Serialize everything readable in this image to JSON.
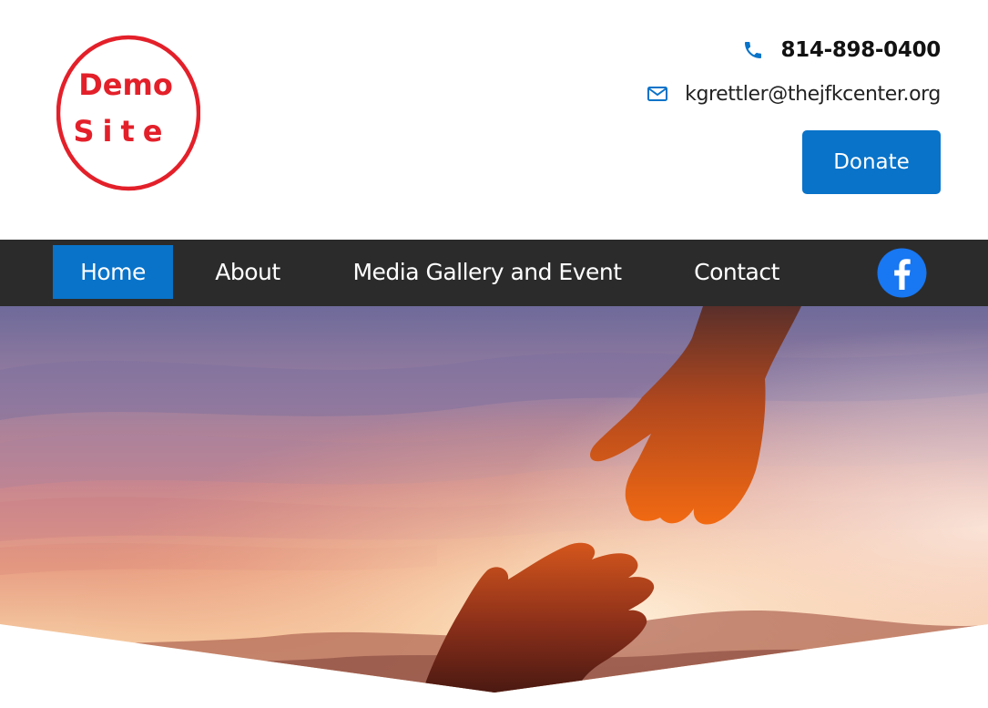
{
  "logo": {
    "line1": "Demo",
    "line2": "Site",
    "color": "#e3202a"
  },
  "header": {
    "phone": "814-898-0400",
    "email": "kgrettler@thejfkcenter.org",
    "donate_label": "Donate",
    "phone_icon": "phone-icon",
    "email_icon": "envelope-icon"
  },
  "nav": {
    "items": [
      {
        "label": "Home",
        "active": true
      },
      {
        "label": "About",
        "active": false
      },
      {
        "label": "Media Gallery and Event",
        "active": false
      },
      {
        "label": "Contact",
        "active": false
      }
    ],
    "social_icon": "facebook-icon"
  },
  "hero": {
    "image": "silhouetted hands reaching toward each other against a sunset sky"
  },
  "colors": {
    "accent": "#0873c9",
    "navbar_bg": "#2b2b2b",
    "logo_red": "#e3202a"
  }
}
